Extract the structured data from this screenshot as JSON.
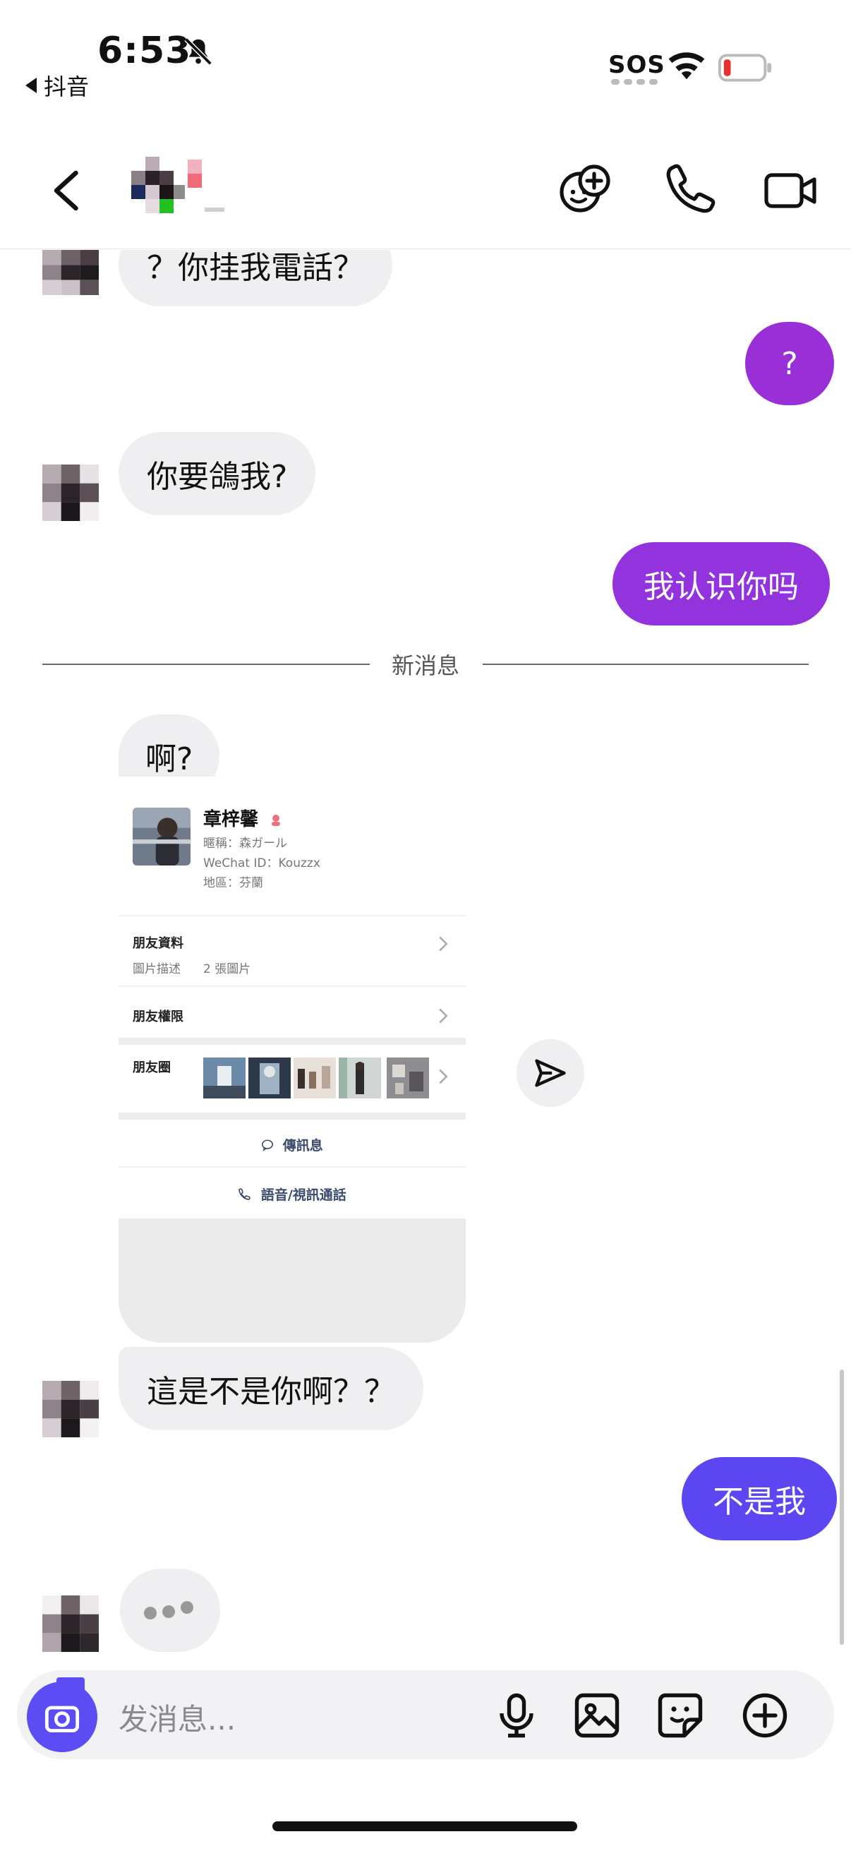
{
  "status_bar": {
    "time": "6:53",
    "back_app": "抖音",
    "sos": "SOS"
  },
  "header": {
    "contact_name_hidden": ""
  },
  "messages": {
    "m1_text": "？你挂我電話？",
    "m2_text": "?",
    "m3_text": "你要鴿我?",
    "m4_text": "我认识你吗",
    "divider": "新消息",
    "m5_text": "啊?",
    "m6_text": "這是不是你啊？？",
    "m7_text": "不是我"
  },
  "card": {
    "name": "章梓馨",
    "nickname": "暱稱：森ガール",
    "wechat_id": "WeChat ID：Kouzzx",
    "region": "地區：芬蘭",
    "profile_label": "朋友資料",
    "photo_desc_label": "圖片描述",
    "photo_desc_value": "2 張圖片",
    "permission_label": "朋友權限",
    "moments_label": "朋友圈",
    "send_message": "傳訊息",
    "voice_video_call": "語音/視訊通話"
  },
  "input": {
    "placeholder": "发消息..."
  },
  "colors": {
    "bubble_out_purple": "#9a2fd8",
    "bubble_out_violet": "#7a33e6",
    "bubble_out_blue": "#5b46f2",
    "bubble_in": "#efeff2",
    "camera_button": "#5b4cf4"
  }
}
